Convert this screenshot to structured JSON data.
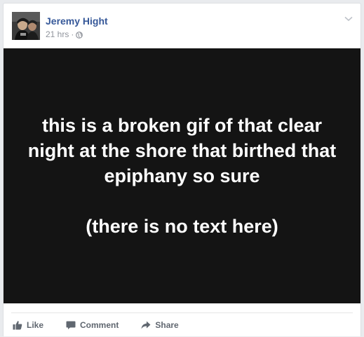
{
  "post": {
    "author_name": "Jeremy Hight",
    "timestamp": "21 hrs",
    "separator": "·",
    "privacy_icon": "globe-icon",
    "menu_icon": "chevron-down-icon"
  },
  "media": {
    "lines": [
      "this is a broken gif of that clear night at the shore that birthed that epiphany so sure",
      "(there is no text here)"
    ],
    "background": "#141414",
    "text_color": "#ffffff"
  },
  "actions": {
    "like_label": "Like",
    "like_icon": "thumbs-up-icon",
    "comment_label": "Comment",
    "comment_icon": "comment-bubble-icon",
    "share_label": "Share",
    "share_icon": "share-arrow-icon"
  },
  "colors": {
    "author_link": "#365899",
    "meta_text": "#90949c",
    "action_text": "#606770",
    "page_bg": "#e9ebee"
  }
}
